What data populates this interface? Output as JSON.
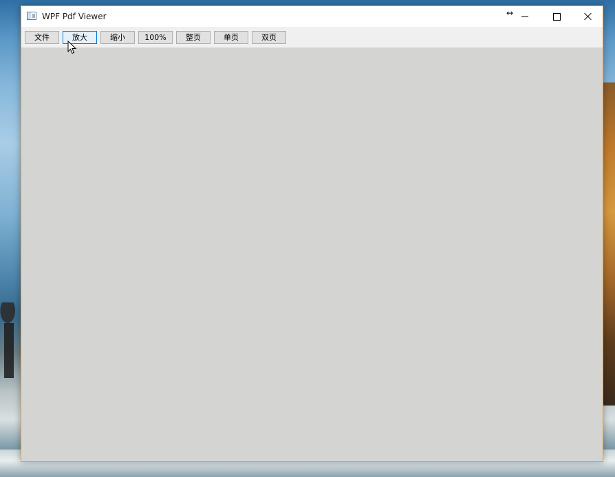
{
  "window": {
    "title": "WPF Pdf Viewer",
    "icon": "app-window-icon",
    "caption_buttons": {
      "resize_indicator": "↔",
      "minimize": "minimize-icon",
      "maximize": "maximize-icon",
      "close": "close-icon"
    }
  },
  "toolbar": {
    "buttons": [
      {
        "label": "文件",
        "state": "normal"
      },
      {
        "label": "放大",
        "state": "hover"
      },
      {
        "label": "缩小",
        "state": "normal"
      },
      {
        "label": "100%",
        "state": "normal"
      },
      {
        "label": "整页",
        "state": "normal"
      },
      {
        "label": "单页",
        "state": "normal"
      },
      {
        "label": "双页",
        "state": "normal"
      }
    ]
  },
  "colors": {
    "window_border": "#e0a14a",
    "button_hover_bg": "#e5f1fb",
    "button_hover_border": "#0078d7",
    "viewer_bg": "#d4d4d2"
  }
}
